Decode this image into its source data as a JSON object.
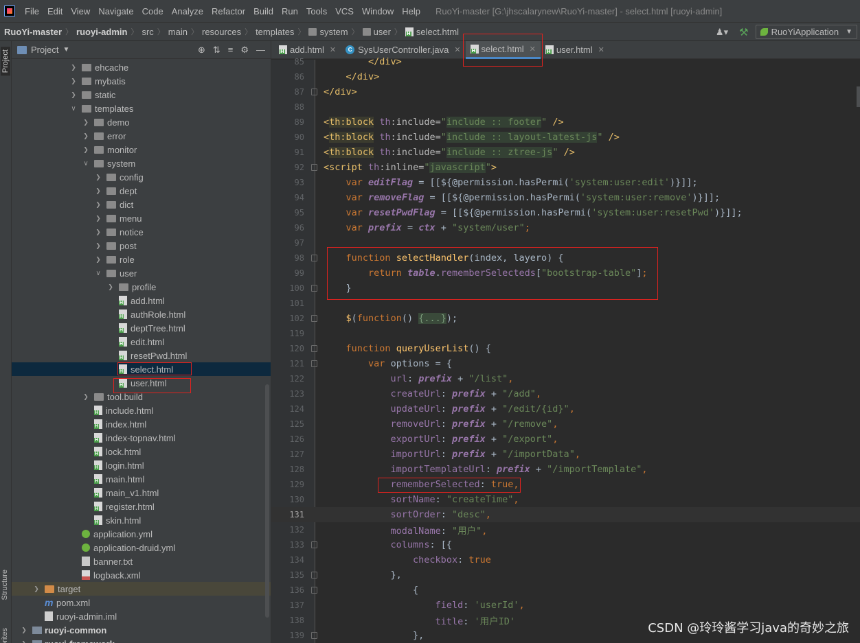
{
  "menubar": {
    "items": [
      "File",
      "Edit",
      "View",
      "Navigate",
      "Code",
      "Analyze",
      "Refactor",
      "Build",
      "Run",
      "Tools",
      "VCS",
      "Window",
      "Help"
    ],
    "window_title": "RuoYi-master [G:\\jhscalarynew\\RuoYi-master] - select.html [ruoyi-admin]"
  },
  "breadcrumb": {
    "project": "RuoYi-master",
    "module": "ruoyi-admin",
    "path": [
      "src",
      "main",
      "resources",
      "templates",
      "system",
      "user"
    ],
    "file": "select.html"
  },
  "run_config": {
    "label": "RuoYiApplication"
  },
  "side_tabs": {
    "project": "Project",
    "structure": "Structure",
    "favorites": "Favorites"
  },
  "project_panel": {
    "title": "Project",
    "rows": [
      {
        "depth": 5,
        "arrow": "right",
        "icon": "folder",
        "label": "ehcache"
      },
      {
        "depth": 5,
        "arrow": "right",
        "icon": "folder",
        "label": "mybatis"
      },
      {
        "depth": 5,
        "arrow": "right",
        "icon": "folder",
        "label": "static"
      },
      {
        "depth": 5,
        "arrow": "down",
        "icon": "folder",
        "label": "templates"
      },
      {
        "depth": 6,
        "arrow": "right",
        "icon": "folder",
        "label": "demo"
      },
      {
        "depth": 6,
        "arrow": "right",
        "icon": "folder",
        "label": "error"
      },
      {
        "depth": 6,
        "arrow": "right",
        "icon": "folder",
        "label": "monitor"
      },
      {
        "depth": 6,
        "arrow": "down",
        "icon": "folder",
        "label": "system"
      },
      {
        "depth": 7,
        "arrow": "right",
        "icon": "folder",
        "label": "config"
      },
      {
        "depth": 7,
        "arrow": "right",
        "icon": "folder",
        "label": "dept"
      },
      {
        "depth": 7,
        "arrow": "right",
        "icon": "folder",
        "label": "dict"
      },
      {
        "depth": 7,
        "arrow": "right",
        "icon": "folder",
        "label": "menu"
      },
      {
        "depth": 7,
        "arrow": "right",
        "icon": "folder",
        "label": "notice"
      },
      {
        "depth": 7,
        "arrow": "right",
        "icon": "folder",
        "label": "post"
      },
      {
        "depth": 7,
        "arrow": "right",
        "icon": "folder",
        "label": "role"
      },
      {
        "depth": 7,
        "arrow": "down",
        "icon": "folder",
        "label": "user"
      },
      {
        "depth": 8,
        "arrow": "right",
        "icon": "folder",
        "label": "profile"
      },
      {
        "depth": 8,
        "arrow": "none",
        "icon": "html",
        "label": "add.html"
      },
      {
        "depth": 8,
        "arrow": "none",
        "icon": "html",
        "label": "authRole.html"
      },
      {
        "depth": 8,
        "arrow": "none",
        "icon": "html",
        "label": "deptTree.html"
      },
      {
        "depth": 8,
        "arrow": "none",
        "icon": "html",
        "label": "edit.html"
      },
      {
        "depth": 8,
        "arrow": "none",
        "icon": "html",
        "label": "resetPwd.html"
      },
      {
        "depth": 8,
        "arrow": "none",
        "icon": "html",
        "label": "select.html",
        "selected": true
      },
      {
        "depth": 8,
        "arrow": "none",
        "icon": "html",
        "label": "user.html"
      },
      {
        "depth": 6,
        "arrow": "right",
        "icon": "folder",
        "label": "tool.build"
      },
      {
        "depth": 6,
        "arrow": "none",
        "icon": "html",
        "label": "include.html"
      },
      {
        "depth": 6,
        "arrow": "none",
        "icon": "html",
        "label": "index.html"
      },
      {
        "depth": 6,
        "arrow": "none",
        "icon": "html",
        "label": "index-topnav.html"
      },
      {
        "depth": 6,
        "arrow": "none",
        "icon": "html",
        "label": "lock.html"
      },
      {
        "depth": 6,
        "arrow": "none",
        "icon": "html",
        "label": "login.html"
      },
      {
        "depth": 6,
        "arrow": "none",
        "icon": "html",
        "label": "main.html"
      },
      {
        "depth": 6,
        "arrow": "none",
        "icon": "html",
        "label": "main_v1.html"
      },
      {
        "depth": 6,
        "arrow": "none",
        "icon": "html",
        "label": "register.html"
      },
      {
        "depth": 6,
        "arrow": "none",
        "icon": "html",
        "label": "skin.html"
      },
      {
        "depth": 5,
        "arrow": "none",
        "icon": "yml",
        "label": "application.yml"
      },
      {
        "depth": 5,
        "arrow": "none",
        "icon": "yml",
        "label": "application-druid.yml"
      },
      {
        "depth": 5,
        "arrow": "none",
        "icon": "txt",
        "label": "banner.txt"
      },
      {
        "depth": 5,
        "arrow": "none",
        "icon": "xml",
        "label": "logback.xml"
      },
      {
        "depth": 2,
        "arrow": "right",
        "icon": "folder-orange",
        "label": "target",
        "highlight": true
      },
      {
        "depth": 2,
        "arrow": "none",
        "icon": "maven",
        "label": "pom.xml"
      },
      {
        "depth": 2,
        "arrow": "none",
        "icon": "iml",
        "label": "ruoyi-admin.iml"
      },
      {
        "depth": 1,
        "arrow": "right",
        "icon": "module",
        "label": "ruoyi-common",
        "bold": true
      },
      {
        "depth": 1,
        "arrow": "right",
        "icon": "module",
        "label": "ruoyi-framework",
        "bold": true
      }
    ]
  },
  "editor": {
    "tabs": [
      {
        "label": "add.html",
        "icon": "html",
        "active": false
      },
      {
        "label": "SysUserController.java",
        "icon": "class",
        "active": false
      },
      {
        "label": "select.html",
        "icon": "html",
        "active": true
      },
      {
        "label": "user.html",
        "icon": "html",
        "active": false
      }
    ],
    "current_line": "131",
    "lines": [
      {
        "n": "85",
        "html": "        <span class='tag'>&lt;/div&gt;</span>"
      },
      {
        "n": "86",
        "html": "    <span class='tag'>&lt;/div&gt;</span>"
      },
      {
        "n": "87",
        "html": "<span class='tag'>&lt;/div&gt;</span>"
      },
      {
        "n": "88",
        "html": ""
      },
      {
        "n": "89",
        "html": "<span class='tag'>&lt;</span><span class='tag th-bg'>th:block</span> <span class='ns'>th</span><span class='attr'>:include=</span><span class='str'>\"<span class='hl-bg'>include :: footer</span>\"</span> <span class='tag'>/&gt;</span>"
      },
      {
        "n": "90",
        "html": "<span class='tag'>&lt;</span><span class='tag th-bg'>th:block</span> <span class='ns'>th</span><span class='attr'>:include=</span><span class='str'>\"<span class='hl-bg'>include :: layout-latest-js</span>\"</span> <span class='tag'>/&gt;</span>"
      },
      {
        "n": "91",
        "html": "<span class='tag'>&lt;</span><span class='tag th-bg'>th:block</span> <span class='ns'>th</span><span class='attr'>:include=</span><span class='str'>\"<span class='hl-bg'>include :: ztree-js</span>\"</span> <span class='tag'>/&gt;</span>"
      },
      {
        "n": "92",
        "html": "<span class='tag'>&lt;script</span> <span class='ns'>th</span><span class='attr'>:inline=</span><span class='str'>\"<span class='hl-bg'>javascript</span>\"</span><span class='tag'>&gt;</span>"
      },
      {
        "n": "93",
        "html": "    <span class='kw'>var</span> <span class='var'>editFlag</span> <span class='plain'>= [[${@permission.hasPermi(</span><span class='str'>'system:user:edit'</span><span class='plain'>)}]];</span>"
      },
      {
        "n": "94",
        "html": "    <span class='kw'>var</span> <span class='var'>removeFlag</span> <span class='plain'>= [[${@permission.hasPermi(</span><span class='str'>'system:user:remove'</span><span class='plain'>)}]];</span>"
      },
      {
        "n": "95",
        "html": "    <span class='kw'>var</span> <span class='var'>resetPwdFlag</span> <span class='plain'>= [[${@permission.hasPermi(</span><span class='str'>'system:user:resetPwd'</span><span class='plain'>)}]];</span>"
      },
      {
        "n": "96",
        "html": "    <span class='kw'>var</span> <span class='var'>prefix</span> <span class='plain'>= </span><span class='var'>ctx</span> <span class='plain'>+ </span><span class='str'>\"system/user\"</span><span class='kw'>;</span>"
      },
      {
        "n": "97",
        "html": ""
      },
      {
        "n": "98",
        "html": "    <span class='kw'>function</span> <span class='fn'>selectHandler</span><span class='plain'>(index, </span><span class='plain'>layero</span><span class='plain'>) {</span>"
      },
      {
        "n": "99",
        "html": "        <span class='kw'>return</span> <span class='var'>table</span><span class='plain'>.</span><span class='prop'>rememberSelecteds</span><span class='plain'>[</span><span class='str'>\"bootstrap-table\"</span><span class='plain'>]</span><span class='kw'>;</span>"
      },
      {
        "n": "100",
        "html": "    <span class='plain'>}</span>"
      },
      {
        "n": "101",
        "html": ""
      },
      {
        "n": "102",
        "html": "    <span class='fn'>$</span><span class='plain'>(</span><span class='kw'>function</span><span class='plain'>() </span><span class='folded'>{...}</span><span class='plain'>);</span>"
      },
      {
        "n": "119",
        "html": ""
      },
      {
        "n": "120",
        "html": "    <span class='kw'>function</span> <span class='fn'>queryUserList</span><span class='plain'>() {</span>"
      },
      {
        "n": "121",
        "html": "        <span class='kw'>var</span> <span class='plain'>options = {</span>"
      },
      {
        "n": "122",
        "html": "            <span class='prop'>url</span><span class='plain'>: </span><span class='var'>prefix</span> <span class='plain'>+ </span><span class='str'>\"/list\"</span><span class='kw'>,</span>"
      },
      {
        "n": "123",
        "html": "            <span class='prop'>createUrl</span><span class='plain'>: </span><span class='var'>prefix</span> <span class='plain'>+ </span><span class='str'>\"/add\"</span><span class='kw'>,</span>"
      },
      {
        "n": "124",
        "html": "            <span class='prop'>updateUrl</span><span class='plain'>: </span><span class='var'>prefix</span> <span class='plain'>+ </span><span class='str'>\"/edit/{id}\"</span><span class='kw'>,</span>"
      },
      {
        "n": "125",
        "html": "            <span class='prop'>removeUrl</span><span class='plain'>: </span><span class='var'>prefix</span> <span class='plain'>+ </span><span class='str'>\"/remove\"</span><span class='kw'>,</span>"
      },
      {
        "n": "126",
        "html": "            <span class='prop'>exportUrl</span><span class='plain'>: </span><span class='var'>prefix</span> <span class='plain'>+ </span><span class='str'>\"/export\"</span><span class='kw'>,</span>"
      },
      {
        "n": "127",
        "html": "            <span class='prop'>importUrl</span><span class='plain'>: </span><span class='var'>prefix</span> <span class='plain'>+ </span><span class='str'>\"/importData\"</span><span class='kw'>,</span>"
      },
      {
        "n": "128",
        "html": "            <span class='prop'>importTemplateUrl</span><span class='plain'>: </span><span class='var'>prefix</span> <span class='plain'>+ </span><span class='str'>\"/importTemplate\"</span><span class='kw'>,</span>"
      },
      {
        "n": "129",
        "html": "            <span class='prop'>rememberSelected</span><span class='plain'>: </span><span class='kw'>true,</span>"
      },
      {
        "n": "130",
        "html": "            <span class='prop'>sortName</span><span class='plain'>: </span><span class='str'>\"createTime\"</span><span class='kw'>,</span>"
      },
      {
        "n": "131",
        "html": "            <span class='prop'>sortOrder</span><span class='plain'>: </span><span class='str'>\"desc\"</span><span class='kw'>,</span>"
      },
      {
        "n": "132",
        "html": "            <span class='prop'>modalName</span><span class='plain'>: </span><span class='str'>\"用户\"</span><span class='kw'>,</span>"
      },
      {
        "n": "133",
        "html": "            <span class='prop'>columns</span><span class='plain'>: [{</span>"
      },
      {
        "n": "134",
        "html": "                <span class='prop'>checkbox</span><span class='plain'>: </span><span class='kw'>true</span>"
      },
      {
        "n": "135",
        "html": "            <span class='plain'>},</span>"
      },
      {
        "n": "136",
        "html": "                <span class='plain'>{</span>"
      },
      {
        "n": "137",
        "html": "                    <span class='prop'>field</span><span class='plain'>: </span><span class='str'>'userId'</span><span class='kw'>,</span>"
      },
      {
        "n": "138",
        "html": "                    <span class='prop'>title</span><span class='plain'>: </span><span class='str'>'用户ID'</span>"
      },
      {
        "n": "139",
        "html": "                <span class='plain'>},</span>"
      }
    ]
  },
  "watermark": "CSDN @玲玲酱学习java的奇妙之旅"
}
